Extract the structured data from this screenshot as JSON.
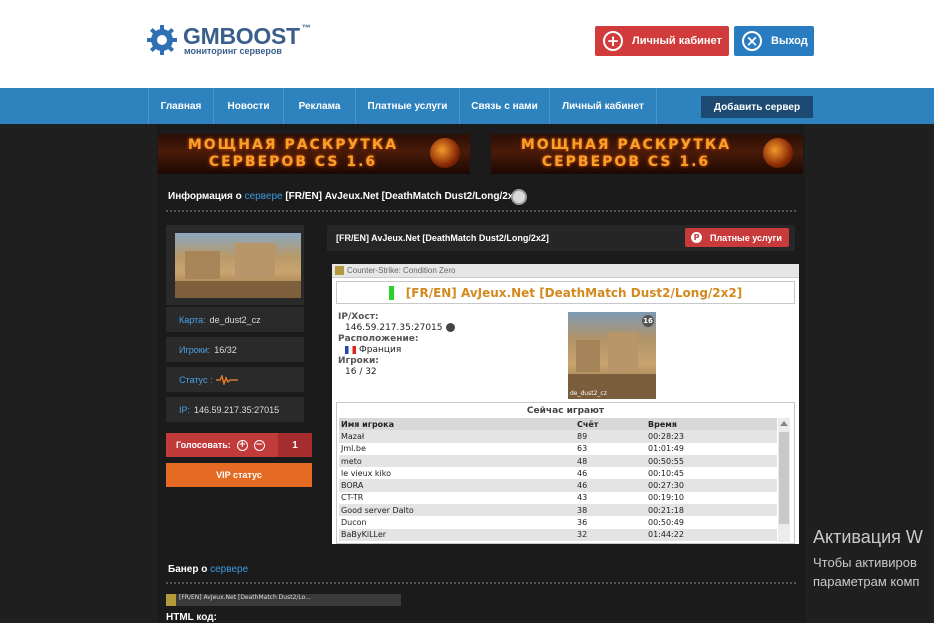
{
  "header": {
    "logo_title": "GMBOOST",
    "logo_tm": "™",
    "logo_sub": "мониторинг серверов",
    "cabinet_label": "Личный кабинет",
    "exit_label": "Выход",
    "cabinet_icon": "plus-circle-icon",
    "exit_icon": "close-circle-icon"
  },
  "nav": {
    "items": [
      "Главная",
      "Новости",
      "Реклама",
      "Платные услуги",
      "Связь с нами",
      "Личный кабинет"
    ],
    "add_server": "Добавить сервер"
  },
  "banners": {
    "line1": "МОЩНАЯ РАСКРУТКА",
    "line2": "СЕРВЕРОВ CS 1.6"
  },
  "info": {
    "title_prefix": "Информация о ",
    "title_link": "сервере",
    "title_server": " [FR/EN] AvJeux.Net [DeathMatch Dust2/Long/2x2]"
  },
  "left": {
    "map_label": "Карта:",
    "map_value": "de_dust2_cz",
    "players_label": "Игроки:",
    "players_value": "16/32",
    "status_label": "Статус :",
    "ip_label": "IP:",
    "ip_value": "146.59.217.35:27015",
    "vote_label": "Голосовать:",
    "vote_count": "1",
    "vip_label": "VIP статус"
  },
  "server": {
    "name": "[FR/EN] AvJeux.Net [DeathMatch Dust2/Long/2x2]",
    "paid_label": "Платные услуги"
  },
  "widget": {
    "game": "Counter-Strike: Condition Zero",
    "title": "[FR/EN] AvJeux.Net [DeathMatch Dust2/Long/2x2]",
    "ip_key": "IP/Хост:",
    "ip_val": "146.59.217.35:27015",
    "loc_key": "Расположение:",
    "loc_val": "Франция",
    "pl_key": "Игроки:",
    "pl_val": "16 / 32",
    "map_num": "16",
    "map_cap": "de_dust2_cz",
    "now_playing": "Сейчас играют",
    "columns": [
      "Имя игрока",
      "Счёт",
      "Время"
    ],
    "rows": [
      [
        "Mazał",
        "89",
        "00:28:23"
      ],
      [
        "Jml.be",
        "63",
        "01:01:49"
      ],
      [
        "meto",
        "48",
        "00:50:55"
      ],
      [
        "le vieux kiko",
        "46",
        "00:10:45"
      ],
      [
        "BORA",
        "46",
        "00:27:30"
      ],
      [
        "CT-TR",
        "43",
        "00:19:10"
      ],
      [
        "Good server Dalto",
        "38",
        "00:21:18"
      ],
      [
        "Ducon",
        "36",
        "00:50:49"
      ],
      [
        "BaByKiLLer",
        "32",
        "01:44:22"
      ]
    ]
  },
  "banner_section": {
    "title_prefix": "Банер о ",
    "title_link": "сервере",
    "mini_text": "[FR/EN] AvJeux.Net [DeathMatch Dust2/Lo...",
    "html_label": "HTML код:"
  },
  "activation": {
    "title": "Активация W",
    "line1": "Чтобы активиров",
    "line2": "параметрам комп"
  }
}
